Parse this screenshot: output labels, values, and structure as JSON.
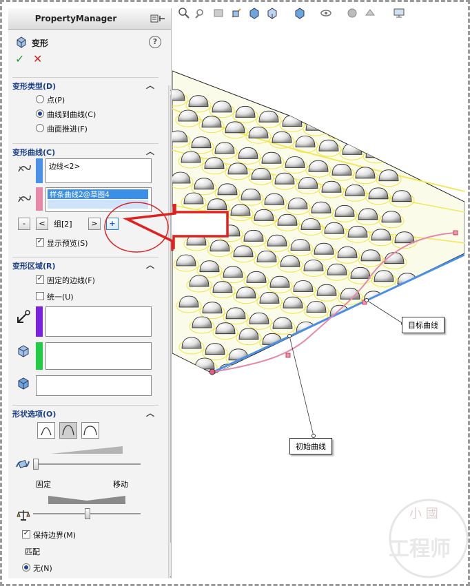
{
  "panel": {
    "title": "PropertyManager",
    "feature_name": "变形",
    "help": "?",
    "ok": "✓",
    "cancel": "✕"
  },
  "deform_type": {
    "title": "变形类型(D)",
    "options": [
      "点(P)",
      "曲线到曲线(C)",
      "曲面推进(F)"
    ],
    "selected": "曲线到曲线(C)"
  },
  "deform_curves": {
    "title": "变形曲线(C)",
    "initial_curve": "边线<2>",
    "target_curve": "样条曲线2@草图4",
    "group_label": "组[2]",
    "minus_btn": "-",
    "prev_btn": "<",
    "next_btn": ">",
    "add_btn": "+",
    "show_preview": "显示预览(S)"
  },
  "deform_region": {
    "title": "变形区域(R)",
    "fixed_edges": "固定的边线(F)",
    "uniform": "统一(U)"
  },
  "shape_options": {
    "title": "形状选项(O)",
    "fixed_label": "固定",
    "move_label": "移动",
    "slider1": 0.0,
    "slider2": 0.5,
    "keep_boundary": "保持边界(M)",
    "match_label": "匹配",
    "match_none": "无(N)"
  },
  "viewport": {
    "target_curve_label": "目标曲线",
    "initial_curve_label": "初始曲线"
  },
  "watermark": {
    "line1": "小 國",
    "line2": "工程师"
  },
  "colors": {
    "accent": "#1a3f8a",
    "initial_curve": "#4a8fe8",
    "target_curve": "#e888a8",
    "fixed_edge": "#7a22dd",
    "region": "#22cc44",
    "arrow": "#dd2222"
  }
}
